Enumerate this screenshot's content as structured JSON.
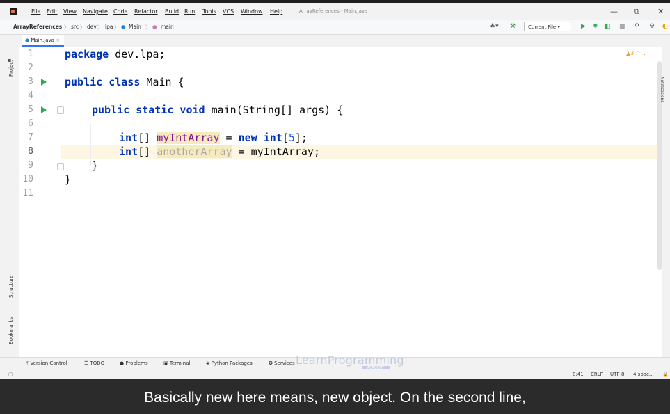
{
  "menu": {
    "items": [
      "File",
      "Edit",
      "View",
      "Navigate",
      "Code",
      "Refactor",
      "Build",
      "Run",
      "Tools",
      "VCS",
      "Window",
      "Help"
    ],
    "window_title": "ArrayReferences - Main.java",
    "window_controls": {
      "minimize": "—",
      "restore": "⧉",
      "close": "✕"
    }
  },
  "navbar": {
    "project": "ArrayReferences",
    "crumbs": [
      "src",
      "dev",
      "lpa",
      "Main",
      "main"
    ],
    "run_config": "Current File ▾"
  },
  "side_tools": {
    "project": "Project",
    "structure": "Structure",
    "bookmarks": "Bookmarks",
    "notifications": "Notifications"
  },
  "tab": {
    "label": "Main.java",
    "close": "×"
  },
  "editor": {
    "line_numbers": [
      "1",
      "2",
      "3",
      "4",
      "5",
      "6",
      "7",
      "8",
      "9",
      "10",
      "11"
    ],
    "lines": {
      "l1_kw": "package",
      "l1_rest": " dev.lpa;",
      "l3_kw": "public class",
      "l3_rest": " Main {",
      "l5_kw": "public static void",
      "l5_rest": " main(String[] args) {",
      "l7_kw1": "int",
      "l7_br": "[] ",
      "l7_var": "myIntArray",
      "l7_eq": " = ",
      "l7_kw2": "new",
      "l7_sp": " ",
      "l7_kw3": "int",
      "l7_o": "[",
      "l7_num": "5",
      "l7_c": "];",
      "l8_kw1": "int",
      "l8_br": "[] ",
      "l8_var": "anotherArray",
      "l8_rest": " = myIntArray;",
      "l9": "}",
      "l10": "}"
    },
    "inspection_widget": "▲3 ^ ⌄"
  },
  "bottom_tools": [
    "Version Control",
    "TODO",
    "Problems",
    "Terminal",
    "Python Packages",
    "Services"
  ],
  "status": {
    "position": "8:41",
    "line_sep": "CRLF",
    "encoding": "UTF-8",
    "indent": "4 spac…"
  },
  "watermark": {
    "text": "LearnProgramming",
    "sub": "ACADEMY"
  },
  "subtitle": "Basically new here means, new object. On the second line,"
}
